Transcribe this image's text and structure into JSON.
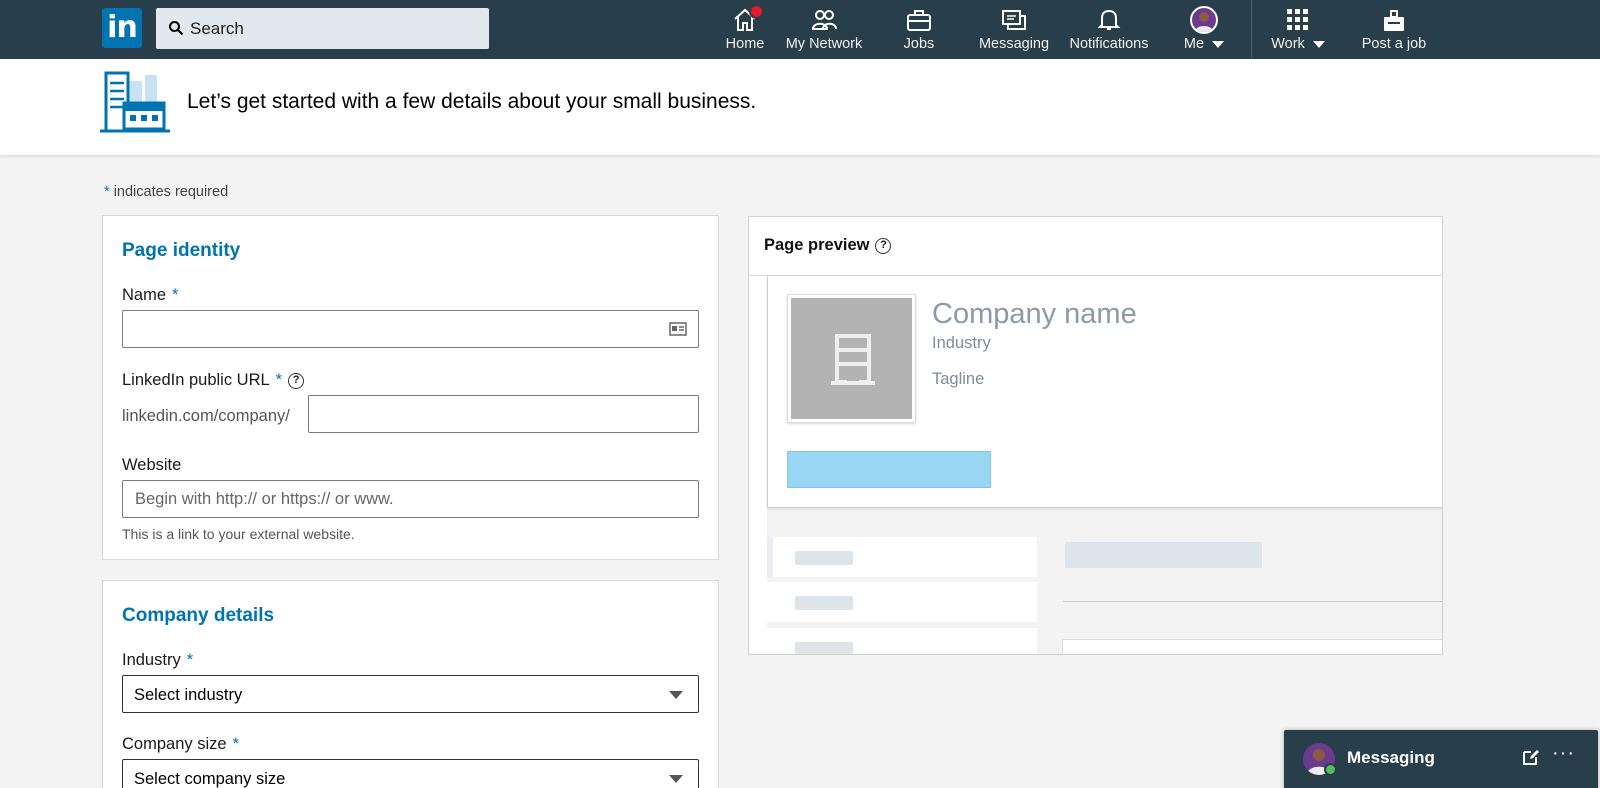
{
  "nav": {
    "logo_text": "in",
    "search_placeholder": "Search",
    "items": [
      {
        "label": "Home",
        "icon": "home-icon"
      },
      {
        "label": "My Network",
        "icon": "network-icon"
      },
      {
        "label": "Jobs",
        "icon": "briefcase-icon"
      },
      {
        "label": "Messaging",
        "icon": "chat-icon"
      },
      {
        "label": "Notifications",
        "icon": "bell-icon"
      },
      {
        "label": "Me",
        "icon": "avatar"
      },
      {
        "label": "Work",
        "icon": "grid-icon"
      },
      {
        "label": "Post a job",
        "icon": "post-job-icon"
      }
    ]
  },
  "banner": {
    "text": "Let’s get started with a few details about your small business."
  },
  "required_note": {
    "star": "*",
    "text": "indicates required"
  },
  "page_identity": {
    "title": "Page identity",
    "name_label": "Name",
    "name_value": "",
    "url_label": "LinkedIn public URL",
    "url_prefix": "linkedin.com/company/",
    "url_value": "",
    "website_label": "Website",
    "website_placeholder": "Begin with http:// or https:// or www.",
    "website_hint": "This is a link to your external website."
  },
  "company_details": {
    "title": "Company details",
    "industry_label": "Industry",
    "industry_value": "Select industry",
    "size_label": "Company size",
    "size_value": "Select company size"
  },
  "preview": {
    "title": "Page preview",
    "company_name": "Company name",
    "industry": "Industry",
    "tagline": "Tagline"
  },
  "messaging": {
    "label": "Messaging",
    "more": "···"
  },
  "colors": {
    "nav_bg": "#283e4a",
    "brand_blue": "#0073b1",
    "preview_button": "#98d6f3"
  }
}
